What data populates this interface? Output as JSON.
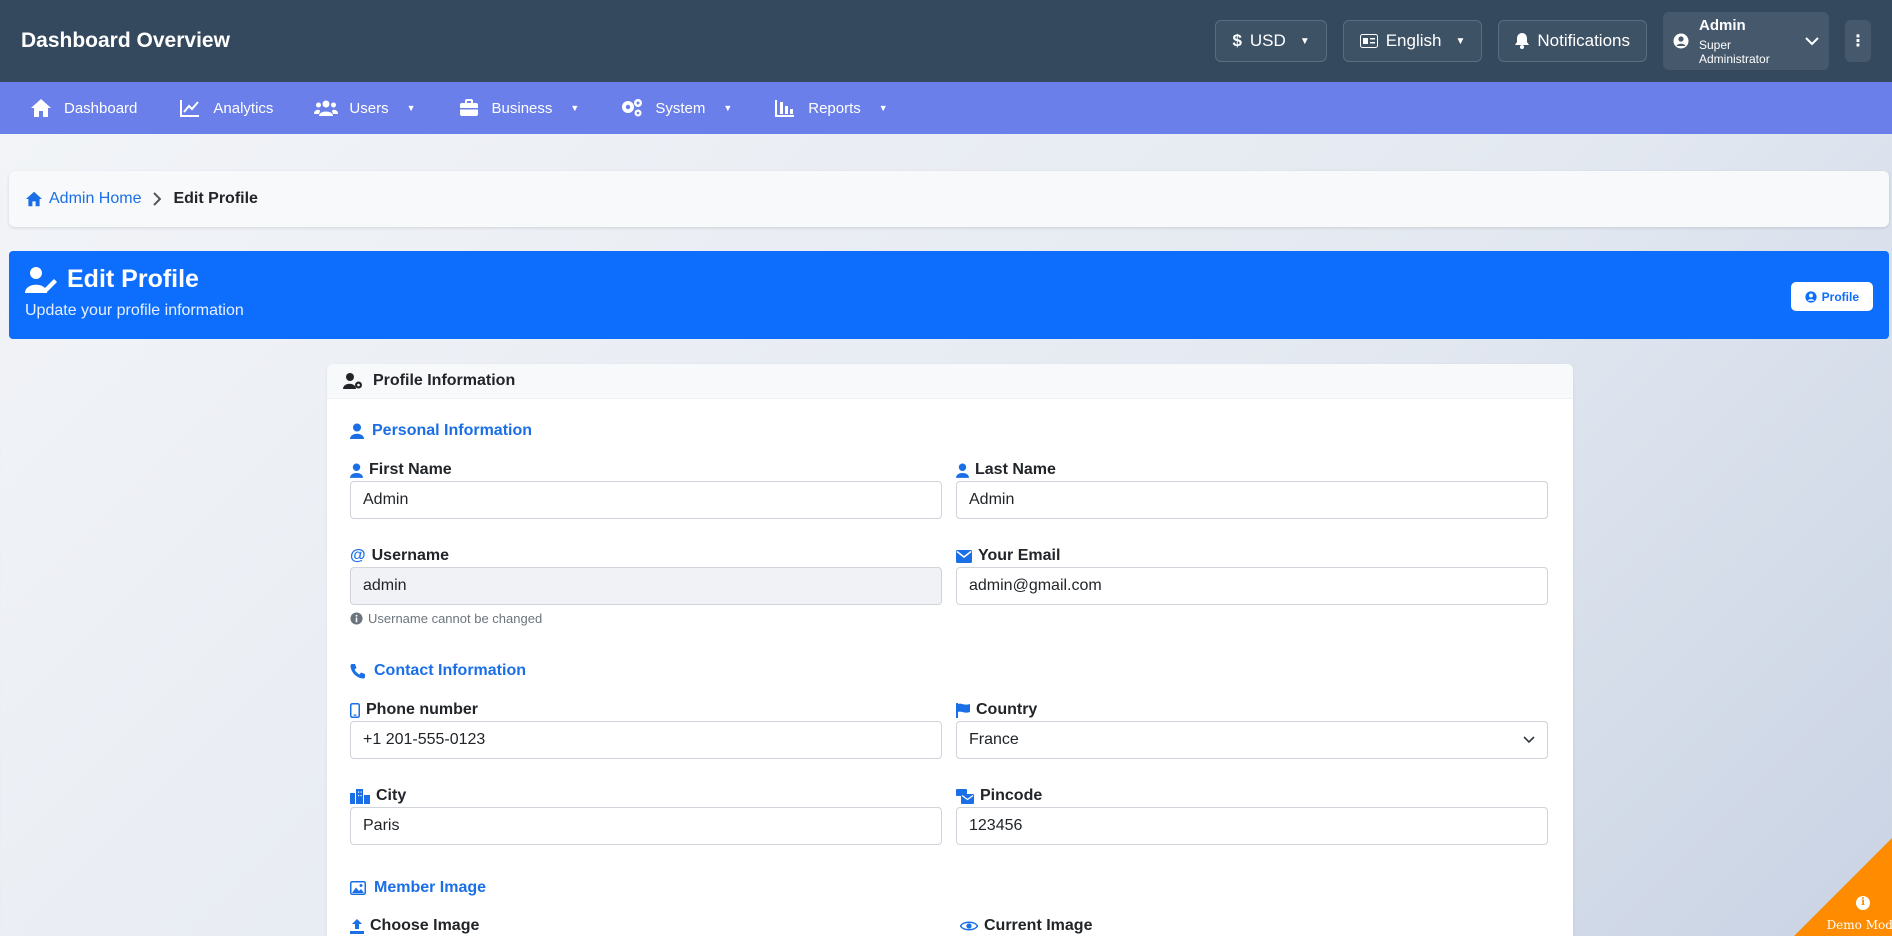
{
  "topbar": {
    "title": "Dashboard Overview",
    "currency_label": "USD",
    "language_label": "English",
    "notifications_label": "Notifications",
    "user_name": "Admin",
    "user_role": "Super Administrator"
  },
  "nav": {
    "items": [
      {
        "label": "Dashboard",
        "icon": "home-icon"
      },
      {
        "label": "Analytics",
        "icon": "chart-line-icon"
      },
      {
        "label": "Users",
        "icon": "users-icon"
      },
      {
        "label": "Business",
        "icon": "briefcase-icon"
      },
      {
        "label": "System",
        "icon": "gears-icon"
      },
      {
        "label": "Reports",
        "icon": "bar-chart-icon"
      }
    ]
  },
  "breadcrumb": {
    "home": "Admin Home",
    "current": "Edit Profile"
  },
  "banner": {
    "title": "Edit Profile",
    "subtitle": "Update your profile information",
    "profile_button": "Profile"
  },
  "card": {
    "header": "Profile Information",
    "sections": {
      "personal": "Personal Information",
      "contact": "Contact Information",
      "member_image": "Member Image"
    },
    "fields": {
      "first_name": {
        "label": "First Name",
        "value": "Admin"
      },
      "last_name": {
        "label": "Last Name",
        "value": "Admin"
      },
      "username": {
        "label": "Username",
        "value": "admin",
        "hint": "Username cannot be changed"
      },
      "email": {
        "label": "Your Email",
        "value": "admin@gmail.com"
      },
      "phone": {
        "label": "Phone number",
        "value": "+1 201-555-0123"
      },
      "country": {
        "label": "Country",
        "value": "France"
      },
      "city": {
        "label": "City",
        "value": "Paris"
      },
      "pincode": {
        "label": "Pincode",
        "value": "123456"
      },
      "choose_image": {
        "label": "Choose Image"
      },
      "current_image": {
        "label": "Current Image"
      }
    }
  },
  "demo": {
    "label": "Demo Mode"
  },
  "colors": {
    "topbar": "#34495e",
    "navbar": "#6a7fe9",
    "primary": "#0d6efd",
    "demo_ribbon": "#ff8c00"
  }
}
